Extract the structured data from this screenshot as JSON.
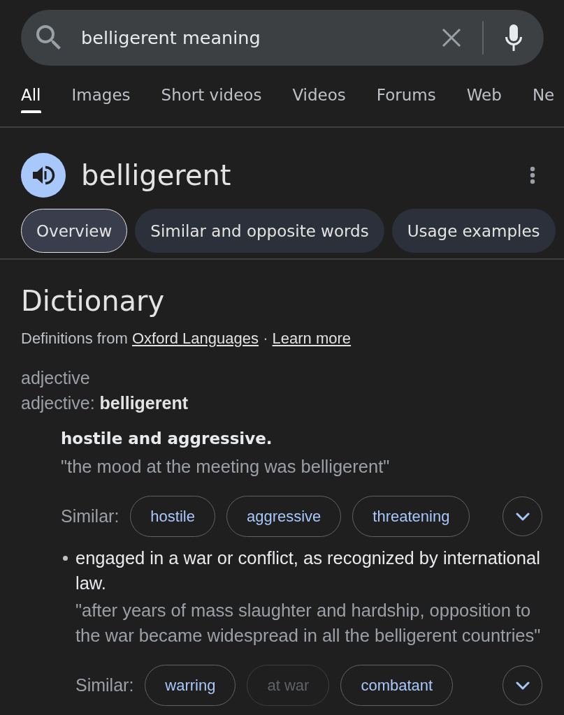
{
  "search": {
    "value": "belligerent meaning"
  },
  "tabs": [
    {
      "label": "All",
      "selected": true
    },
    {
      "label": "Images",
      "selected": false
    },
    {
      "label": "Short videos",
      "selected": false
    },
    {
      "label": "Videos",
      "selected": false
    },
    {
      "label": "Forums",
      "selected": false
    },
    {
      "label": "Web",
      "selected": false
    },
    {
      "label": "Ne",
      "selected": false
    }
  ],
  "entry": {
    "word": "belligerent"
  },
  "sections": [
    {
      "label": "Overview",
      "selected": true
    },
    {
      "label": "Similar and opposite words",
      "selected": false
    },
    {
      "label": "Usage examples",
      "selected": false
    }
  ],
  "dictionary": {
    "title": "Dictionary",
    "source": {
      "prefix": "Definitions from",
      "link": "Oxford Languages",
      "separator": "·",
      "learn_more": "Learn more"
    },
    "part_of_speech": "adjective",
    "headword_line": "adjective: **belligerent**",
    "senses": [
      {
        "kind": "lead",
        "definition": "hostile and aggressive.",
        "example": "\"the mood at the meeting was belligerent\"",
        "similar_label": "Similar:",
        "similar": [
          {
            "word": "hostile",
            "disabled": false
          },
          {
            "word": "aggressive",
            "disabled": false
          },
          {
            "word": "threatening",
            "disabled": false
          }
        ]
      },
      {
        "kind": "bullet",
        "definition": "engaged in a war or conflict, as recognized by international law.",
        "example": "\"after years of mass slaughter and hardship, opposition to the war became widespread in all the belligerent countries\"",
        "similar_label": "Similar:",
        "similar": [
          {
            "word": "warring",
            "disabled": false
          },
          {
            "word": "at war",
            "disabled": true
          },
          {
            "word": "combatant",
            "disabled": false
          }
        ]
      }
    ]
  }
}
